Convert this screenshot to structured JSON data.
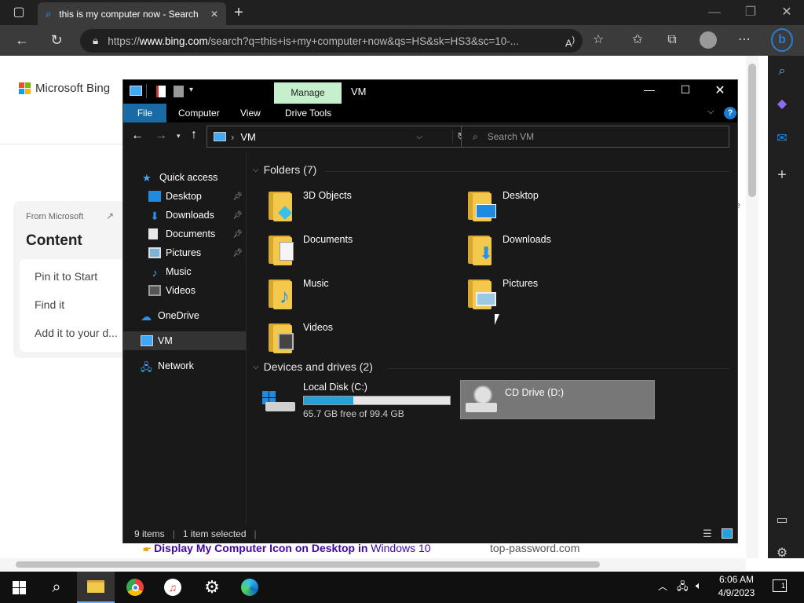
{
  "browser": {
    "tab_title": "this is my computer now - Search",
    "new_tab": "+",
    "url_prefix": "https://",
    "url_domain": "www.bing.com",
    "url_rest": "/search?q=this+is+my+computer+now&qs=HS&sk=HS3&sc=10-..."
  },
  "bing": {
    "logo_text": "Microsoft Bing",
    "card_source": "From Microsoft",
    "card_title": "Content",
    "card_items": [
      "Pin it to Start",
      "Find it",
      "Add it to your d..."
    ],
    "bottom_link_bold": "Display My Computer Icon on Desktop in",
    "bottom_link_rest": " Windows 10",
    "bottom_link_site": "top-password.com",
    "edge_char": "e"
  },
  "explorer": {
    "manage_tab": "Manage",
    "window_title": "VM",
    "ribbon_tabs": [
      "File",
      "Computer",
      "View",
      "Drive Tools"
    ],
    "address": "VM",
    "search_placeholder": "Search VM",
    "nav": {
      "quick_access": "Quick access",
      "desktop": "Desktop",
      "downloads": "Downloads",
      "documents": "Documents",
      "pictures": "Pictures",
      "music": "Music",
      "videos": "Videos",
      "onedrive": "OneDrive",
      "vm": "VM",
      "network": "Network"
    },
    "folders_header": "Folders (7)",
    "folders": [
      "3D Objects",
      "Desktop",
      "Documents",
      "Downloads",
      "Music",
      "Pictures",
      "Videos"
    ],
    "drives_header": "Devices and drives (2)",
    "drive_c": {
      "name": "Local Disk (C:)",
      "free_text": "65.7 GB free of 99.4 GB",
      "used_fraction": 0.339
    },
    "drive_d": {
      "name": "CD Drive (D:)"
    },
    "status_items": "9 items",
    "status_selected": "1 item selected"
  },
  "taskbar": {
    "time": "6:06 AM",
    "date": "4/9/2023",
    "notif_count": "1"
  },
  "colors": {
    "accent": "#0078d4",
    "folder": "#f2c94c",
    "manage_tab": "#c6efce",
    "taskbar": "#101010"
  }
}
